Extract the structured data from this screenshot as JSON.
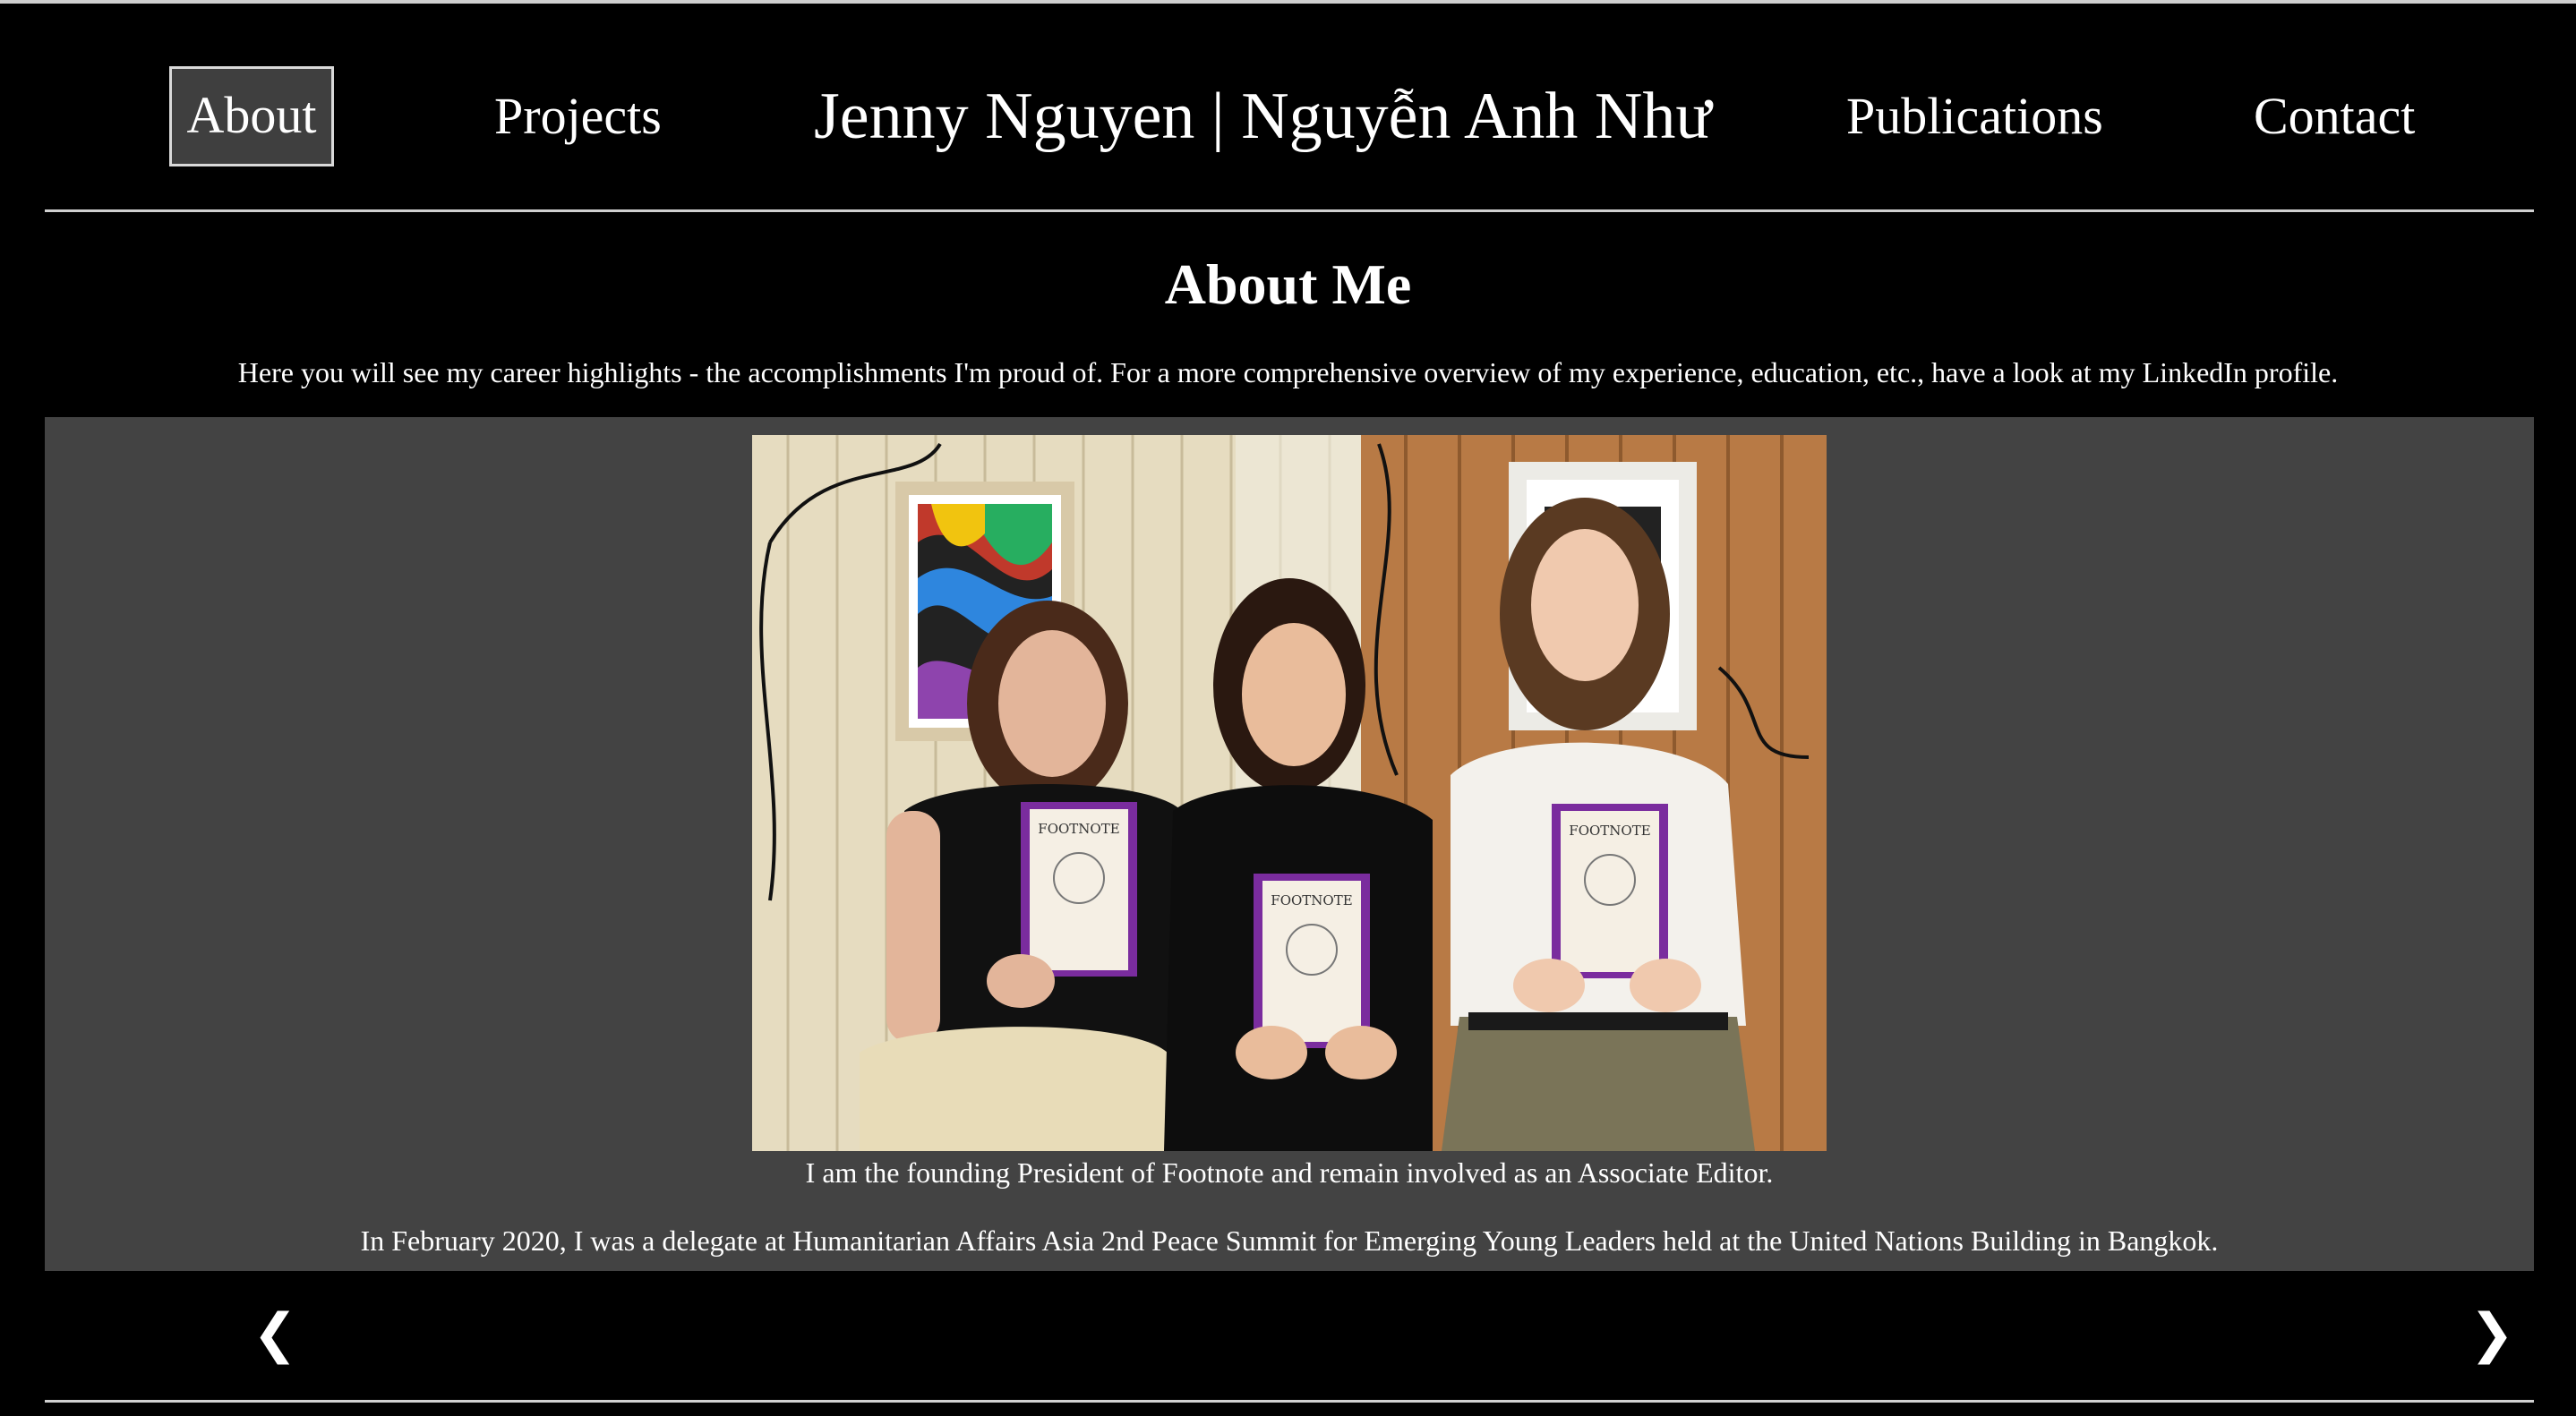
{
  "nav": {
    "about": "About",
    "projects": "Projects",
    "site_title": "Jenny Nguyen | Nguyễn Anh Như",
    "publications": "Publications",
    "contact": "Contact"
  },
  "page": {
    "heading": "About Me",
    "intro": "Here you will see my career highlights - the accomplishments I'm proud of. For a more comprehensive overview of my experience, education, etc., have a look at my LinkedIn profile."
  },
  "slideshow": {
    "caption_1": "I am the founding President of Footnote and remain involved as an Associate Editor.",
    "caption_2": "In February 2020, I was a delegate at Humanitarian Affairs Asia 2nd Peace Summit for Emerging Young Leaders held at the United Nations Building in Bangkok.",
    "prev_glyph": "❮",
    "next_glyph": "❯",
    "photo_booklet_title": "FOOTNOTE"
  },
  "colors": {
    "background": "#000000",
    "slide_background": "#434343",
    "active_nav_background": "#3f3f3f",
    "booklet_accent": "#7a2c9e"
  }
}
